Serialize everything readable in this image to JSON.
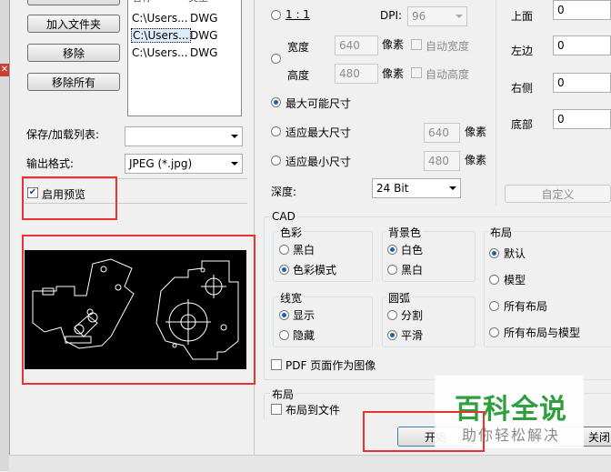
{
  "left_panel": {
    "add_folder_button": "加入文件夹",
    "remove_button": "移除",
    "remove_all_button": "移除所有",
    "list_header": [
      "名称",
      "类型"
    ],
    "file_list": [
      {
        "path": "C:\\Users...",
        "type": "DWG",
        "selected": false
      },
      {
        "path": "C:\\Users...",
        "type": "DWG",
        "selected": true
      },
      {
        "path": "C:\\Users...",
        "type": "DWG",
        "selected": false
      }
    ],
    "save_list_label": "保存/加载列表:",
    "save_list_value": "",
    "output_format_label": "输出格式:",
    "output_format_value": "JPEG (*.jpg)",
    "enable_preview_label": "启用预览",
    "enable_preview_checked": true
  },
  "size": {
    "ratio_label": "1 : 1",
    "dpi_label": "DPI:",
    "dpi_value": "96",
    "width_label": "宽度",
    "width_value": "640",
    "height_label": "高度",
    "height_value": "480",
    "unit_label": "像素",
    "auto_width_label": "自动宽度",
    "auto_height_label": "自动高度",
    "max_possible_label": "最大可能尺寸",
    "fit_max_label": "适应最大尺寸",
    "fit_max_value": "640",
    "fit_min_label": "适应最小尺寸",
    "fit_min_value": "480",
    "depth_label": "深度:",
    "depth_value": "24 Bit"
  },
  "margins": {
    "top_label": "上面",
    "top_value": "0",
    "left_label": "左边",
    "left_value": "0",
    "right_label": "右侧",
    "right_value": "0",
    "bottom_label": "底部",
    "bottom_value": "0",
    "custom_button": "自定义"
  },
  "cad": {
    "title": "CAD",
    "color_title": "色彩",
    "black_white": "黑白",
    "color_mode": "色彩模式",
    "background_title": "背景色",
    "white": "白色",
    "black": "黑白",
    "layout_title": "布局",
    "default": "默认",
    "model": "模型",
    "all_layouts": "所有布局",
    "all_layouts_model": "所有布局与模型",
    "line_width_title": "线宽",
    "show": "显示",
    "hide": "隐藏",
    "arc_title": "圆弧",
    "segment": "分割",
    "smooth": "平滑",
    "pdf_page_as_image": "PDF 页面作为图像",
    "layout_group_title": "布局",
    "layout_to_file": "布局到文件"
  },
  "bottom_buttons": {
    "start_button": "开始",
    "close_button": "关闭"
  },
  "watermark": {
    "title": "百科全说",
    "subtitle": "助你轻松解决"
  },
  "colors": {
    "highlight_red": "#e8322f",
    "watermark_green": "#2e9e3e",
    "selection_blue": "#3399ff"
  }
}
